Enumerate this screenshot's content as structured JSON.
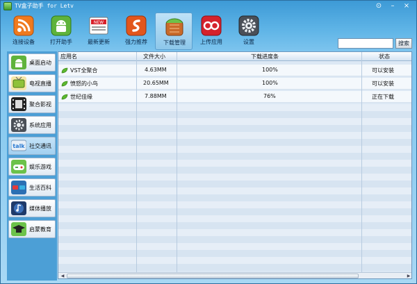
{
  "window": {
    "title": "TV盒子助手 for Letv",
    "minimize": "–",
    "close": "×",
    "pin": "⊙"
  },
  "toolbar": {
    "items": [
      {
        "label": "连接设备",
        "icon": "rss-connect-icon"
      },
      {
        "label": "打开助手",
        "icon": "android-robot-icon"
      },
      {
        "label": "最新更新",
        "icon": "news-icon"
      },
      {
        "label": "强力推荐",
        "icon": "recommend-icon"
      },
      {
        "label": "下载管理",
        "icon": "download-bag-icon"
      },
      {
        "label": "上传应用",
        "icon": "lastfm-upload-icon"
      },
      {
        "label": "设置",
        "icon": "settings-gear-icon"
      }
    ],
    "active_index": 4
  },
  "search": {
    "placeholder": "",
    "button_label": "搜索"
  },
  "sidebar": {
    "items": [
      {
        "label": "桌面启动",
        "icon": "android-desktop-icon"
      },
      {
        "label": "电视直播",
        "icon": "tv-icon"
      },
      {
        "label": "聚合影视",
        "icon": "film-strip-icon"
      },
      {
        "label": "系统应用",
        "icon": "gear-icon"
      },
      {
        "label": "社交通讯",
        "icon": "talk-icon"
      },
      {
        "label": "娱乐游戏",
        "icon": "gamepad-icon"
      },
      {
        "label": "生活百科",
        "icon": "3d-glasses-icon"
      },
      {
        "label": "媒体播放",
        "icon": "music-note-icon"
      },
      {
        "label": "启蒙教育",
        "icon": "grad-cap-icon"
      }
    ],
    "active_index": 4
  },
  "table": {
    "columns": [
      "应用名",
      "文件大小",
      "下载进度条",
      "状态"
    ],
    "rows": [
      {
        "name": "VST全聚合",
        "size": "4.63MM",
        "progress": "100%",
        "status": "可以安装"
      },
      {
        "name": "愤怒的小鸟",
        "size": "20.65MM",
        "progress": "100%",
        "status": "可以安装"
      },
      {
        "name": "世纪佳缘",
        "size": "7.88MM",
        "progress": "76%",
        "status": "正在下载"
      }
    ]
  },
  "colors": {
    "accent": "#4c9fd6",
    "title_bar": "#3d9ad6",
    "grid_bg": "#dce8f4"
  }
}
